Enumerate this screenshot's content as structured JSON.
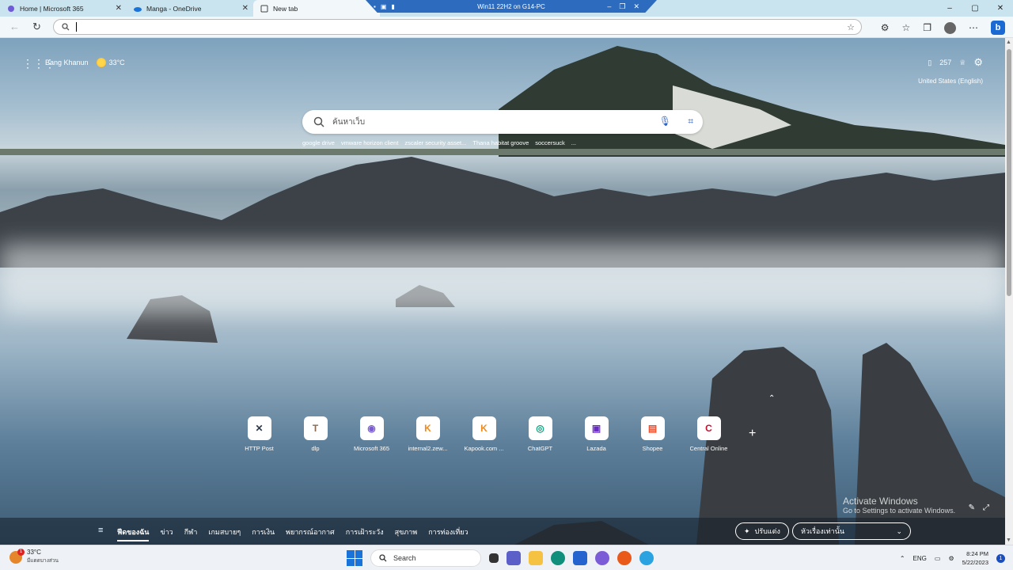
{
  "browser": {
    "tabs": [
      {
        "title": "Home | Microsoft 365",
        "icon": "m365-icon",
        "active": false
      },
      {
        "title": "Manga - OneDrive",
        "icon": "onedrive-icon",
        "active": false
      },
      {
        "title": "New tab",
        "icon": "newtab-icon",
        "active": true
      }
    ],
    "rdp_title": "Win11 22H2 on G14-PC",
    "address_value": ""
  },
  "page": {
    "location": "Bang Khanun",
    "temperature": "33°C",
    "points": "257",
    "language": "United States (English)",
    "search_placeholder": "ค้นหาเว็บ",
    "trending": [
      "google drive",
      "vmware horizon client",
      "zscaler security asset...",
      "Thana habitat groove",
      "soccersuck",
      "..."
    ],
    "quick_links": [
      {
        "label": "HTTP Post",
        "icon": "x-icon",
        "color": "#2e3a4a",
        "glyph": "✕"
      },
      {
        "label": "dlp",
        "icon": "t-icon",
        "color": "#8a6b52",
        "glyph": "T"
      },
      {
        "label": "Microsoft 365",
        "icon": "m365-icon",
        "color": "#7b5cd6",
        "glyph": "◉"
      },
      {
        "label": "internal2.zew...",
        "icon": "kapook-icon",
        "color": "#f08a1c",
        "glyph": "K"
      },
      {
        "label": "Kapook.com ...",
        "icon": "kapook-icon",
        "color": "#f08a1c",
        "glyph": "K"
      },
      {
        "label": "ChatGPT",
        "icon": "chatgpt-icon",
        "color": "#10a37f",
        "glyph": "◎"
      },
      {
        "label": "Lazada",
        "icon": "lazada-icon",
        "color": "#6a2ac8",
        "glyph": "▣"
      },
      {
        "label": "Shopee",
        "icon": "shopee-icon",
        "color": "#ee4d2d",
        "glyph": "▤"
      },
      {
        "label": "Central Online",
        "icon": "central-icon",
        "color": "#c8102e",
        "glyph": "C"
      }
    ],
    "watermark_title": "Activate Windows",
    "watermark_sub": "Go to Settings to activate Windows.",
    "feed_tabs": [
      "ฟีดของฉัน",
      "ข่าว",
      "กีฬา",
      "เกมสบายๆ",
      "การเงิน",
      "พยากรณ์อากาศ",
      "การเฝ้าระวัง",
      "สุขภาพ",
      "การท่องเที่ยว"
    ],
    "customize_label": "ปรับแต่ง",
    "headings_label": "หัวเรื่องเท่านั้น"
  },
  "taskbar": {
    "weather_temp": "33°C",
    "weather_desc": "มีแดดบางส่วน",
    "notif_count": "1",
    "search_label": "Search",
    "input_lang": "ENG",
    "time": "8:24 PM",
    "date": "5/22/2023",
    "notification_badge": "1"
  }
}
